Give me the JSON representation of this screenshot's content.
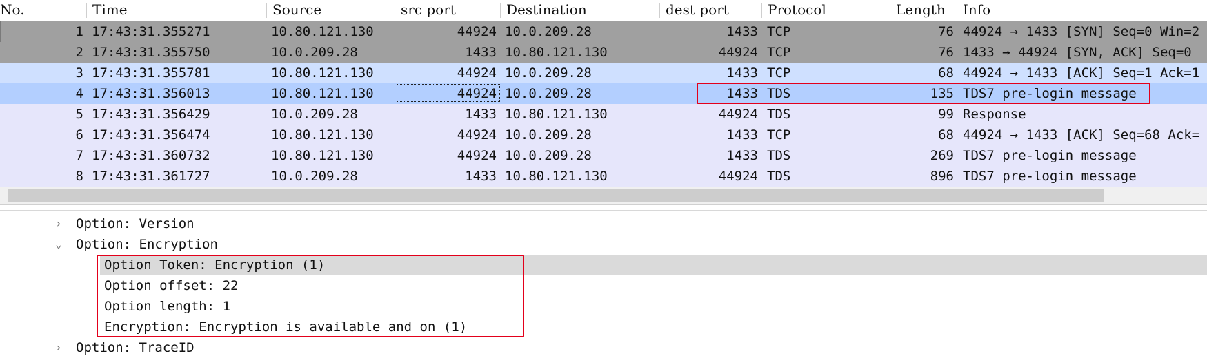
{
  "columns": [
    {
      "key": "no",
      "label": "No."
    },
    {
      "key": "time",
      "label": "Time"
    },
    {
      "key": "source",
      "label": "Source"
    },
    {
      "key": "src_port",
      "label": "src port"
    },
    {
      "key": "destination",
      "label": "Destination"
    },
    {
      "key": "dest_port",
      "label": "dest port"
    },
    {
      "key": "protocol",
      "label": "Protocol"
    },
    {
      "key": "length",
      "label": "Length"
    },
    {
      "key": "info",
      "label": "Info"
    }
  ],
  "packets": [
    {
      "no": "1",
      "time": "17:43:31.355271",
      "source": "10.80.121.130",
      "src_port": "44924",
      "destination": "10.0.209.28",
      "dest_port": "1433",
      "protocol": "TCP",
      "length": "76",
      "info": "44924 → 1433 [SYN] Seq=0 Win=2",
      "style": "gray"
    },
    {
      "no": "2",
      "time": "17:43:31.355750",
      "source": "10.0.209.28",
      "src_port": "1433",
      "destination": "10.80.121.130",
      "dest_port": "44924",
      "protocol": "TCP",
      "length": "76",
      "info": "1433 → 44924 [SYN, ACK] Seq=0",
      "style": "gray"
    },
    {
      "no": "3",
      "time": "17:43:31.355781",
      "source": "10.80.121.130",
      "src_port": "44924",
      "destination": "10.0.209.28",
      "dest_port": "1433",
      "protocol": "TCP",
      "length": "68",
      "info": "44924 → 1433 [ACK] Seq=1 Ack=1",
      "style": "light"
    },
    {
      "no": "4",
      "time": "17:43:31.356013",
      "source": "10.80.121.130",
      "src_port": "44924",
      "destination": "10.0.209.28",
      "dest_port": "1433",
      "protocol": "TDS",
      "length": "135",
      "info": "TDS7 pre-login message",
      "style": "sel"
    },
    {
      "no": "5",
      "time": "17:43:31.356429",
      "source": "10.0.209.28",
      "src_port": "1433",
      "destination": "10.80.121.130",
      "dest_port": "44924",
      "protocol": "TDS",
      "length": "99",
      "info": "Response",
      "style": "lav"
    },
    {
      "no": "6",
      "time": "17:43:31.356474",
      "source": "10.80.121.130",
      "src_port": "44924",
      "destination": "10.0.209.28",
      "dest_port": "1433",
      "protocol": "TCP",
      "length": "68",
      "info": "44924 → 1433 [ACK] Seq=68 Ack=",
      "style": "lav"
    },
    {
      "no": "7",
      "time": "17:43:31.360732",
      "source": "10.80.121.130",
      "src_port": "44924",
      "destination": "10.0.209.28",
      "dest_port": "1433",
      "protocol": "TDS",
      "length": "269",
      "info": "TDS7 pre-login message",
      "style": "lav"
    },
    {
      "no": "8",
      "time": "17:43:31.361727",
      "source": "10.0.209.28",
      "src_port": "1433",
      "destination": "10.80.121.130",
      "dest_port": "44924",
      "protocol": "TDS",
      "length": "896",
      "info": "TDS7 pre-login message",
      "style": "lav"
    }
  ],
  "details": [
    {
      "text": "Option: Version",
      "chevron": "right",
      "chevron_icon": "›",
      "level": 0
    },
    {
      "text": "Option: Encryption",
      "chevron": "down",
      "chevron_icon": "⌄",
      "level": 0
    },
    {
      "text": "Option Token: Encryption (1)",
      "level": 1,
      "highlighted": true
    },
    {
      "text": "Option offset: 22",
      "level": 1
    },
    {
      "text": "Option length: 1",
      "level": 1
    },
    {
      "text": "Encryption: Encryption is available and on (1)",
      "level": 1
    },
    {
      "text": "Option: TraceID",
      "chevron": "right",
      "chevron_icon": "›",
      "level": 0
    }
  ],
  "colors": {
    "row_gray": "#a0a0a0",
    "row_light_blue": "#cfe0ff",
    "row_selected": "#b3cfff",
    "row_lavender": "#e6e6fb",
    "annotation_red": "#e3001b"
  }
}
